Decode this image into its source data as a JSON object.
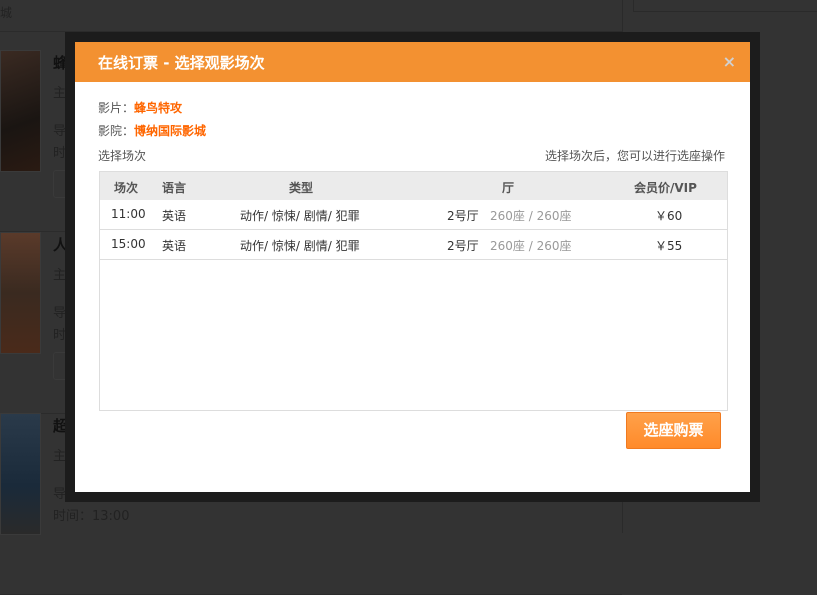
{
  "background": {
    "top_text": "城",
    "movies": [
      {
        "title": "蜂",
        "line1": "主",
        "line2": "导",
        "line3": "时"
      },
      {
        "title": "人",
        "line1": "主",
        "line2": "导",
        "line3": "时"
      },
      {
        "title": "超",
        "line1": "主",
        "line2": "导",
        "line3": "时间：13:00"
      }
    ]
  },
  "modal": {
    "title": "在线订票 - 选择观影场次",
    "close": "×",
    "film_label": "影片：",
    "film": "蜂鸟特攻",
    "cinema_label": "影院：",
    "cinema": "博纳国际影城",
    "select_label": "选择场次",
    "note": "选择场次后，您可以进行选座操作",
    "columns": [
      "场次",
      "语言",
      "类型",
      "厅",
      "会员价/VIP"
    ],
    "rows": [
      {
        "time": "11:00",
        "lang": "英语",
        "genre": "动作/ 惊悚/ 剧情/ 犯罪",
        "hall": "2号厅",
        "seats": "260座 / 260座",
        "price": "￥60"
      },
      {
        "time": "15:00",
        "lang": "英语",
        "genre": "动作/ 惊悚/ 剧情/ 犯罪",
        "hall": "2号厅",
        "seats": "260座 / 260座",
        "price": "￥55"
      }
    ],
    "button": "选座购票"
  },
  "colors": {
    "header": "#f39131",
    "accent": "#ff6600",
    "button": "#ff8f33"
  }
}
